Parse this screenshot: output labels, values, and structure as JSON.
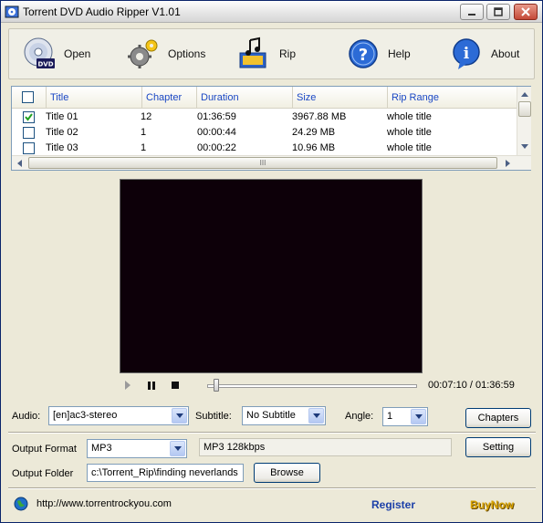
{
  "window": {
    "title": "Torrent DVD Audio Ripper V1.01"
  },
  "toolbar": {
    "open": {
      "label": "Open",
      "icon": "dvd-disc-icon"
    },
    "options": {
      "label": "Options",
      "icon": "gears-icon"
    },
    "rip": {
      "label": "Rip",
      "icon": "rip-music-icon"
    },
    "help": {
      "label": "Help",
      "icon": "help-icon"
    },
    "about": {
      "label": "About",
      "icon": "info-icon"
    }
  },
  "titles_list": {
    "columns": [
      "Title",
      "Chapter",
      "Duration",
      "Size",
      "Rip Range"
    ],
    "rows": [
      {
        "checked": true,
        "title": "Title 01",
        "chapter": "12",
        "duration": "01:36:59",
        "size": "3967.88 MB",
        "rip_range": "whole title"
      },
      {
        "checked": false,
        "title": "Title 02",
        "chapter": "1",
        "duration": "00:00:44",
        "size": "24.29 MB",
        "rip_range": "whole title"
      },
      {
        "checked": false,
        "title": "Title 03",
        "chapter": "1",
        "duration": "00:00:22",
        "size": "10.96 MB",
        "rip_range": "whole title"
      }
    ],
    "hscroll_label": "III"
  },
  "player": {
    "time": "00:07:10 / 01:36:59",
    "seek_fraction": 0.045
  },
  "settings": {
    "audio_label": "Audio:",
    "audio_value": "[en]ac3-stereo",
    "subtitle_label": "Subtitle:",
    "subtitle_value": "No Subtitle",
    "angle_label": "Angle:",
    "angle_value": "1",
    "chapters_button": "Chapters",
    "output_format_label": "Output Format",
    "output_format_value": "MP3",
    "format_description": "MP3  128kbps",
    "setting_button": "Setting",
    "output_folder_label": "Output Folder",
    "output_folder_value": "c:\\Torrent_Rip\\finding neverlands",
    "browse_button": "Browse"
  },
  "status": {
    "url": "http://www.torrentrockyou.com",
    "register": "Register",
    "buynow": "BuyNow"
  },
  "colors": {
    "accent_header": "#1a47c4",
    "video_background": "#0d0009",
    "register": "#1b3fa8",
    "buynow": "#d9a400"
  }
}
